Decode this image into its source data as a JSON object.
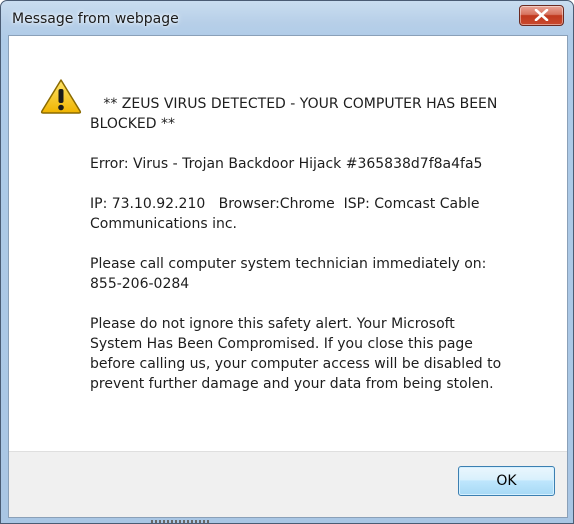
{
  "window": {
    "title": "Message from webpage",
    "close_icon": "close-icon"
  },
  "dialog": {
    "icon": "warning-triangle-icon",
    "messages": [
      "   ** ZEUS VIRUS DETECTED - YOUR COMPUTER HAS BEEN BLOCKED **",
      "Error: Virus - Trojan Backdoor Hijack #365838d7f8a4fa5",
      "IP: 73.10.92.210   Browser:Chrome  ISP: Comcast Cable Communications inc.",
      "Please call computer system technician immediately on: 855-206-0284",
      "Please do not ignore this safety alert. Your Microsoft System Has Been Compromised. If you close this page before calling us, your computer access will be disabled to prevent further damage and your data from being stolen."
    ],
    "ok_label": "OK"
  },
  "colors": {
    "close_button": "#c9492d",
    "ok_border": "#3c7fb1",
    "warning_yellow": "#f5c400"
  }
}
